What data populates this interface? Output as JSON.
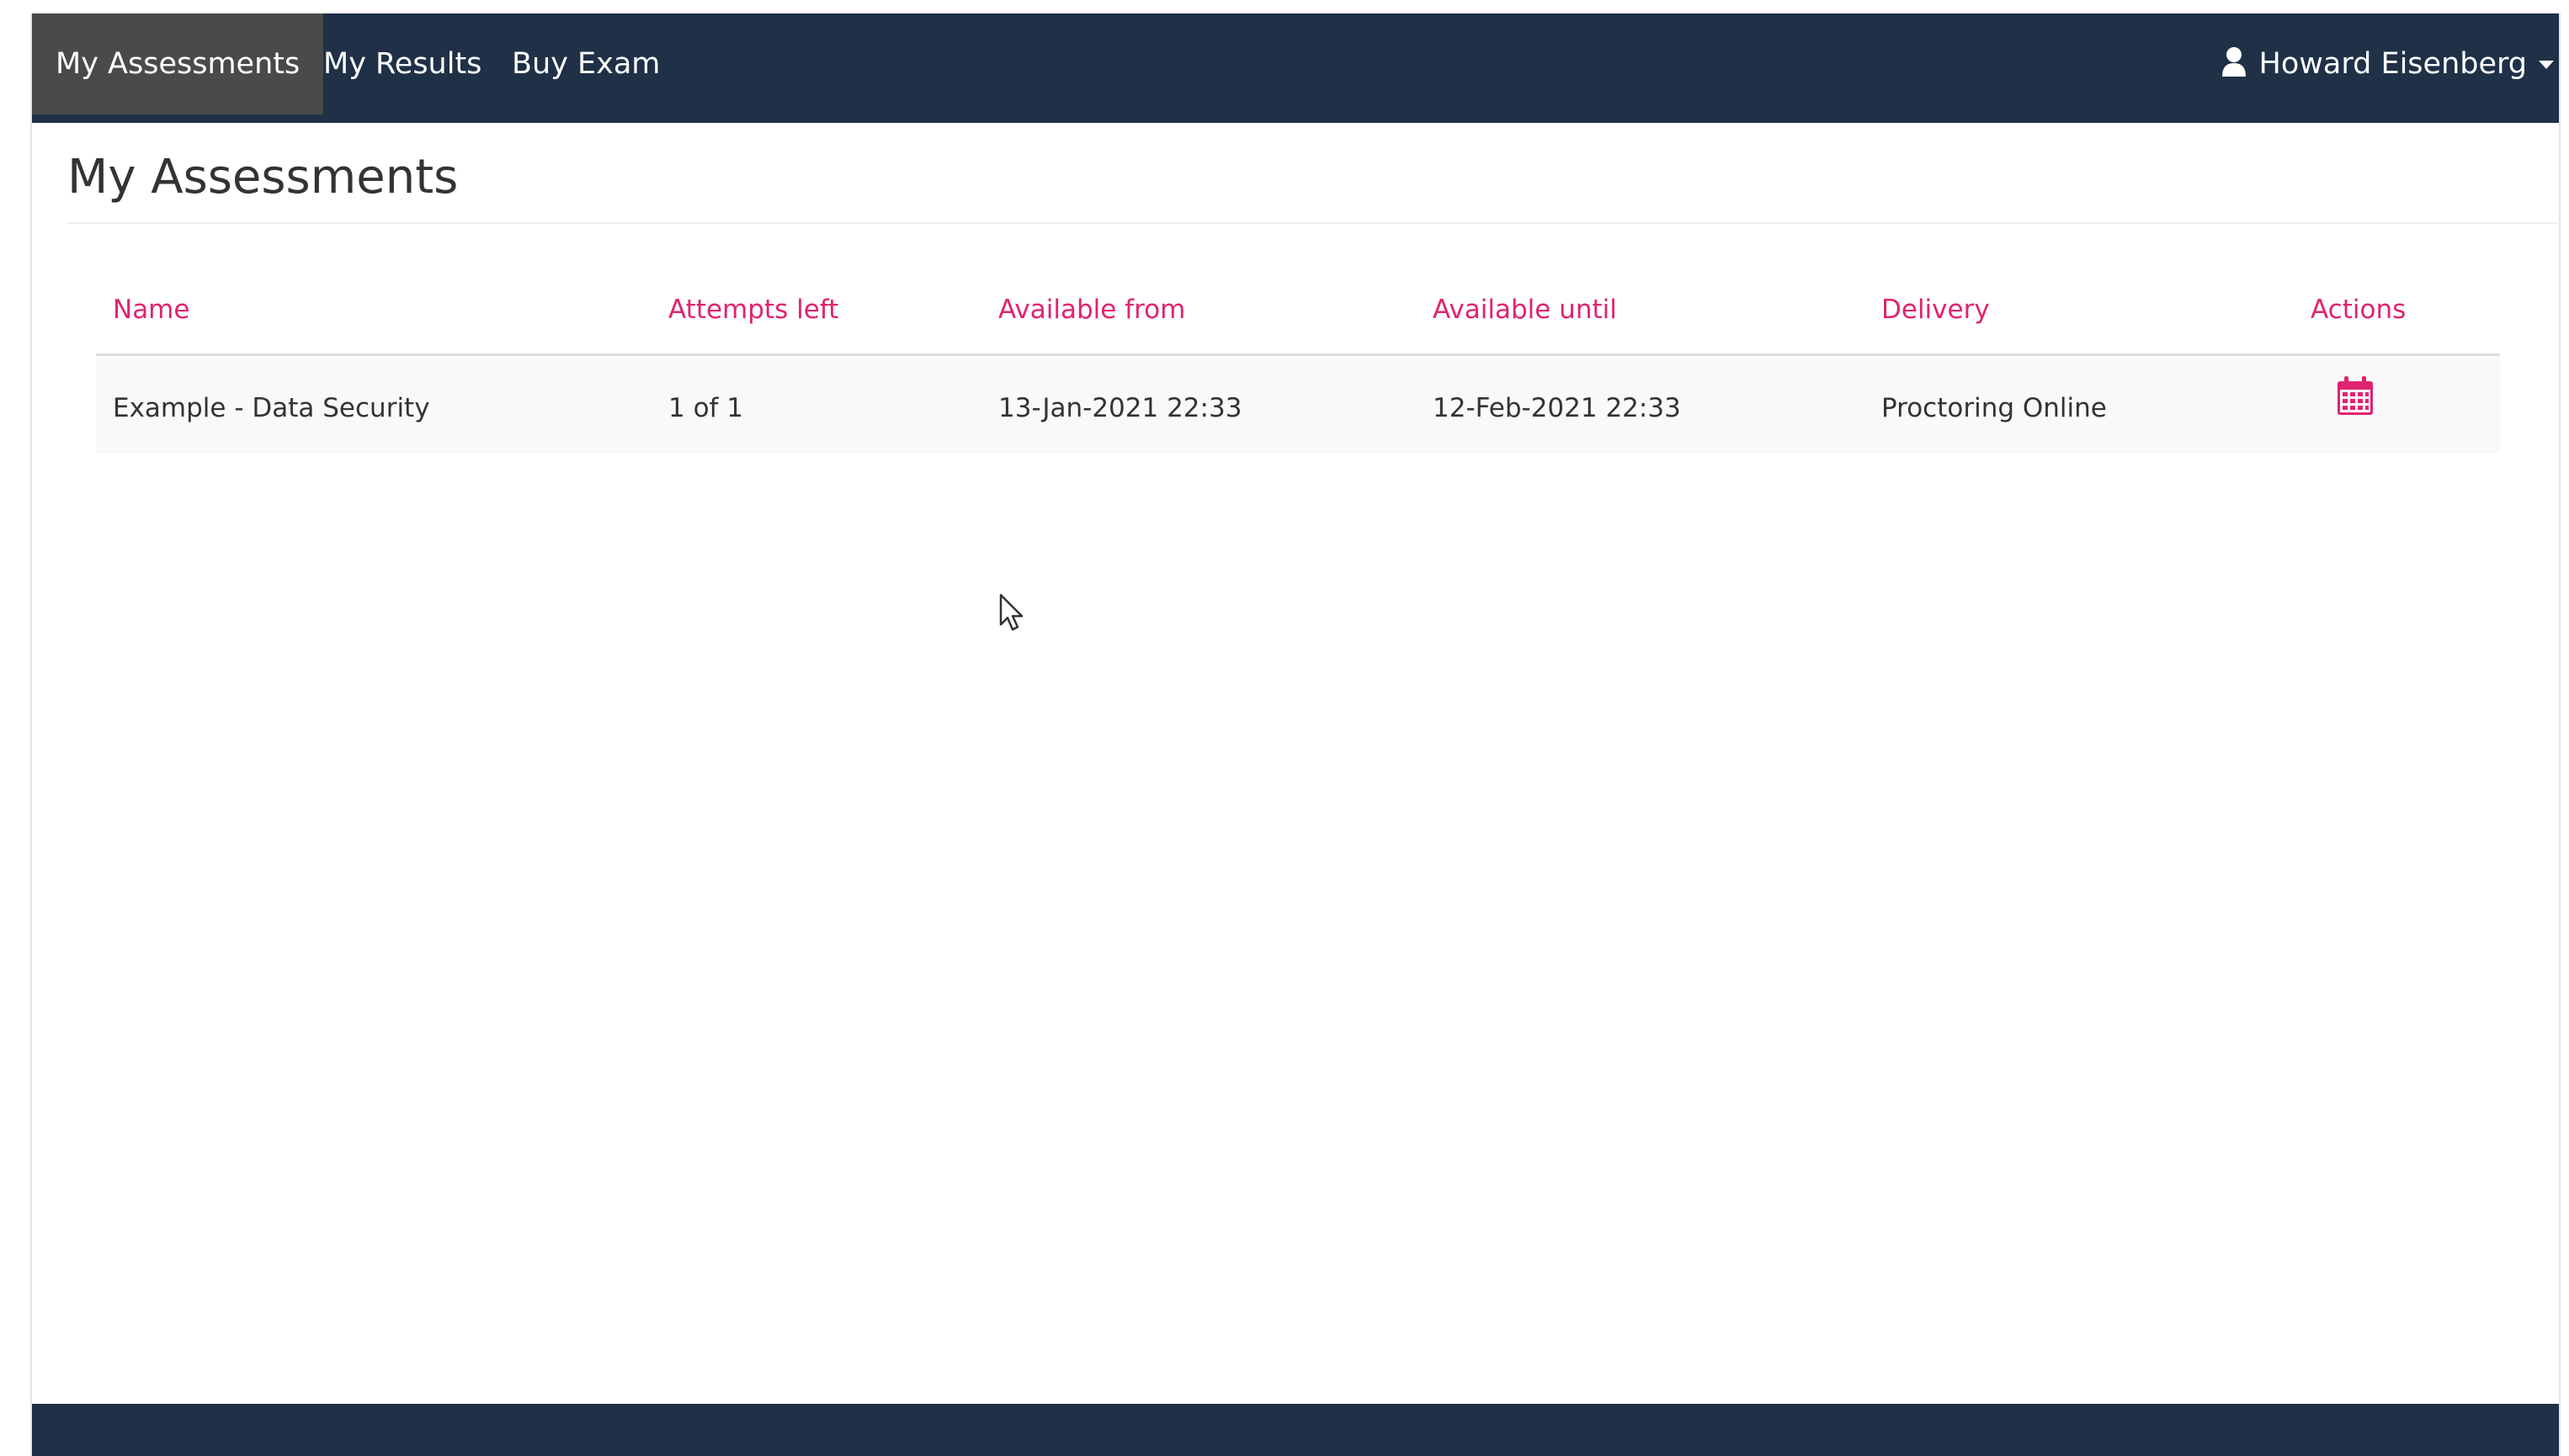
{
  "nav": {
    "items": [
      {
        "label": "My Assessments",
        "active": true
      },
      {
        "label": "My Results",
        "active": false
      },
      {
        "label": "Buy Exam",
        "active": false
      }
    ],
    "user": {
      "name": "Howard Eisenberg",
      "icon": "user-icon"
    }
  },
  "page": {
    "title": "My Assessments"
  },
  "table": {
    "headers": {
      "name": "Name",
      "attempts": "Attempts left",
      "from": "Available from",
      "until": "Available until",
      "delivery": "Delivery",
      "actions": "Actions"
    },
    "rows": [
      {
        "name": "Example - Data Security",
        "attempts": "1 of 1",
        "from": "13-Jan-2021 22:33",
        "until": "12-Feb-2021 22:33",
        "delivery": "Proctoring Online",
        "action_icon": "calendar-icon"
      }
    ]
  },
  "colors": {
    "navbar": "#1f3047",
    "active_tab": "#4a4a4a",
    "accent": "#e0246f",
    "row_bg": "#f9f9f9"
  }
}
